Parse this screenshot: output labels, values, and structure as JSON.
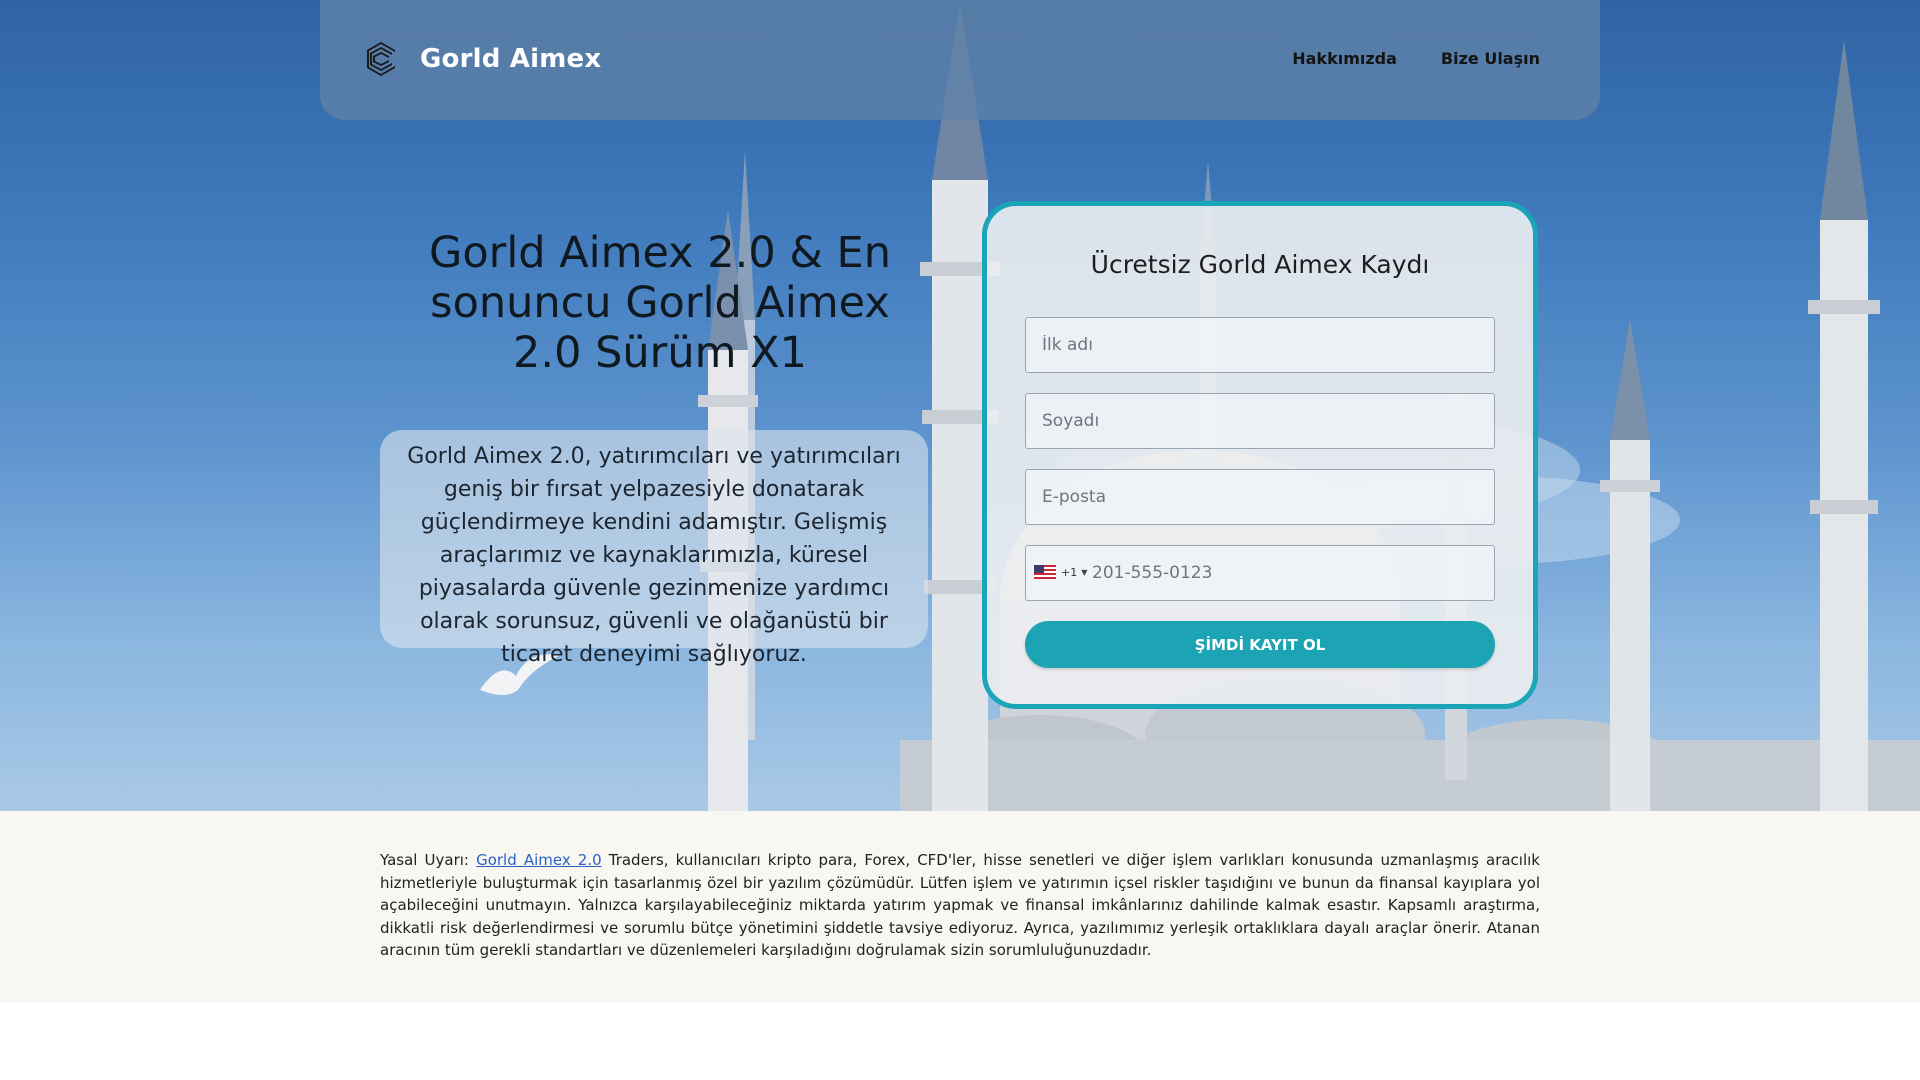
{
  "brand": {
    "name": "Gorld Aimex",
    "logo_icon": "stacked-c-logo-icon"
  },
  "nav": {
    "items": [
      {
        "label": "Hakkımızda"
      },
      {
        "label": "Bize Ulaşın"
      }
    ]
  },
  "hero": {
    "headline": "Gorld Aimex 2.0 & En sonuncu Gorld Aimex 2.0 Sürüm X1",
    "description": "Gorld Aimex 2.0, yatırımcıları ve yatırımcıları geniş bir fırsat yelpazesiyle donatarak güçlendirmeye kendini adamıştır. Gelişmiş araçlarımız ve kaynaklarımızla, küresel piyasalarda güvenle gezinmenize yardımcı olarak sorunsuz, güvenli ve olağanüstü bir ticaret deneyimi sağlıyoruz."
  },
  "form": {
    "title": "Ücretsiz Gorld Aimex Kaydı",
    "first_name": {
      "value": "",
      "placeholder": "İlk adı"
    },
    "last_name": {
      "value": "",
      "placeholder": "Soyadı"
    },
    "email": {
      "value": "",
      "placeholder": "E-posta"
    },
    "phone": {
      "country_flag": "us-flag-icon",
      "dial_code": "+1",
      "value": "",
      "placeholder": "201-555-0123"
    },
    "submit_label": "ŞİMDİ KAYIT OL"
  },
  "disclaimer": {
    "prefix": "Yasal Uyarı: ",
    "link_text": "Gorld Aimex 2.0",
    "body": " Traders, kullanıcıları kripto para, Forex, CFD'ler, hisse senetleri ve diğer işlem varlıkları konusunda uzmanlaşmış aracılık hizmetleriyle buluşturmak için tasarlanmış özel bir yazılım çözümüdür. Lütfen işlem ve yatırımın içsel riskler taşıdığını ve bunun da finansal kayıplara yol açabileceğini unutmayın. Yalnızca karşılayabileceğiniz miktarda yatırım yapmak ve finansal imkânlarınız dahilinde kalmak esastır. Kapsamlı araştırma, dikkatli risk değerlendirmesi ve sorumlu bütçe yönetimini şiddetle tavsiye ediyoruz. Ayrıca, yazılımımız yerleşik ortaklıklara dayalı araçlar önerir. Atanan aracının tüm gerekli standartları ve düzenlemeleri karşıladığını doğrulamak sizin sorumluluğunuzdadır."
  },
  "colors": {
    "accent": "#1ca4b4",
    "link": "#2a62c3",
    "navbar": "#6082a8",
    "footer_bg": "#f8f7f2"
  }
}
